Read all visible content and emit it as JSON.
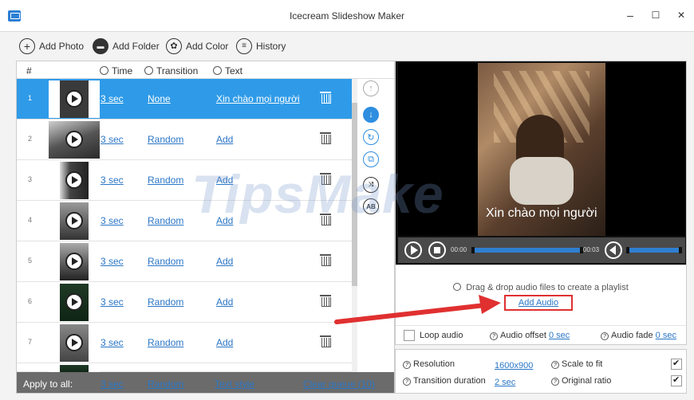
{
  "window": {
    "title": "Icecream Slideshow Maker",
    "minimize": "–",
    "maximize": "☐",
    "close": "✕"
  },
  "toolbar": {
    "add_photo": "Add Photo",
    "add_folder": "Add Folder",
    "add_color": "Add Color",
    "history": "History"
  },
  "list": {
    "headers": {
      "num": "#",
      "time": "Time",
      "transition": "Transition",
      "text": "Text"
    },
    "rows": [
      {
        "num": "1",
        "time": "3 sec",
        "transition": "None",
        "text": "Xin chào mọi người",
        "selected": true
      },
      {
        "num": "2",
        "time": "3 sec",
        "transition": "Random",
        "text": "Add"
      },
      {
        "num": "3",
        "time": "3 sec",
        "transition": "Random",
        "text": "Add"
      },
      {
        "num": "4",
        "time": "3 sec",
        "transition": "Random",
        "text": "Add"
      },
      {
        "num": "5",
        "time": "3 sec",
        "transition": "Random",
        "text": "Add"
      },
      {
        "num": "6",
        "time": "3 sec",
        "transition": "Random",
        "text": "Add"
      },
      {
        "num": "7",
        "time": "3 sec",
        "transition": "Random",
        "text": "Add"
      }
    ],
    "footer": {
      "apply_to_all": "Apply to all:",
      "time": "3 sec",
      "transition": "Random",
      "text_style": "Text style",
      "clear_queue": "Clear queue (10)"
    }
  },
  "preview": {
    "caption": "Xin chào mọi người",
    "time_start": "00:00",
    "time_end": "00:03"
  },
  "audio": {
    "drop_text": "Drag & drop audio files to create a playlist",
    "add_audio": "Add Audio",
    "loop_audio": "Loop audio",
    "audio_offset_label": "Audio offset",
    "audio_offset_value": "0 sec",
    "audio_fade_label": "Audio fade",
    "audio_fade_value": "0 sec"
  },
  "settings": {
    "resolution_label": "Resolution",
    "resolution_value": "1600x900",
    "transition_duration_label": "Transition duration",
    "transition_duration_value": "2 sec",
    "scale_to_fit": "Scale to fit",
    "original_ratio": "Original ratio"
  },
  "watermark": "TipsMake",
  "colors": {
    "accent": "#2f9be8",
    "link": "#2a76c6",
    "highlight": "#e03030"
  }
}
